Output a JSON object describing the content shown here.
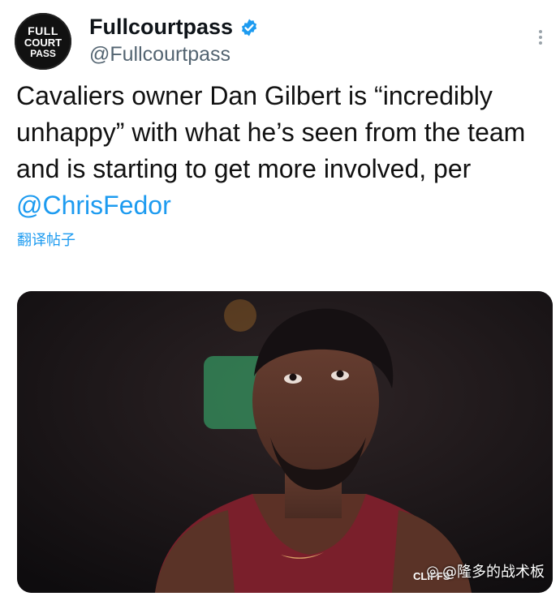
{
  "account": {
    "avatar_text": [
      "FULL",
      "COURT",
      "PASS"
    ],
    "display_name": "Fullcourtpass",
    "handle": "@Fullcourtpass",
    "verified_icon": "verified-badge-icon",
    "more_icon": "more-vertical-icon"
  },
  "tweet": {
    "text": "Cavaliers owner Dan Gilbert is “incredibly unhappy” with what he’s seen from the team and is starting to get more involved, per ",
    "mention": "@ChrisFedor",
    "translate_label": "翻译帖子"
  },
  "media": {
    "jersey_text": "CLIFFS",
    "watermark": "@隆多的战术板"
  },
  "colors": {
    "link": "#1d9bf0",
    "verified": "#1d9bf0",
    "jersey": "#7a1f2b"
  }
}
